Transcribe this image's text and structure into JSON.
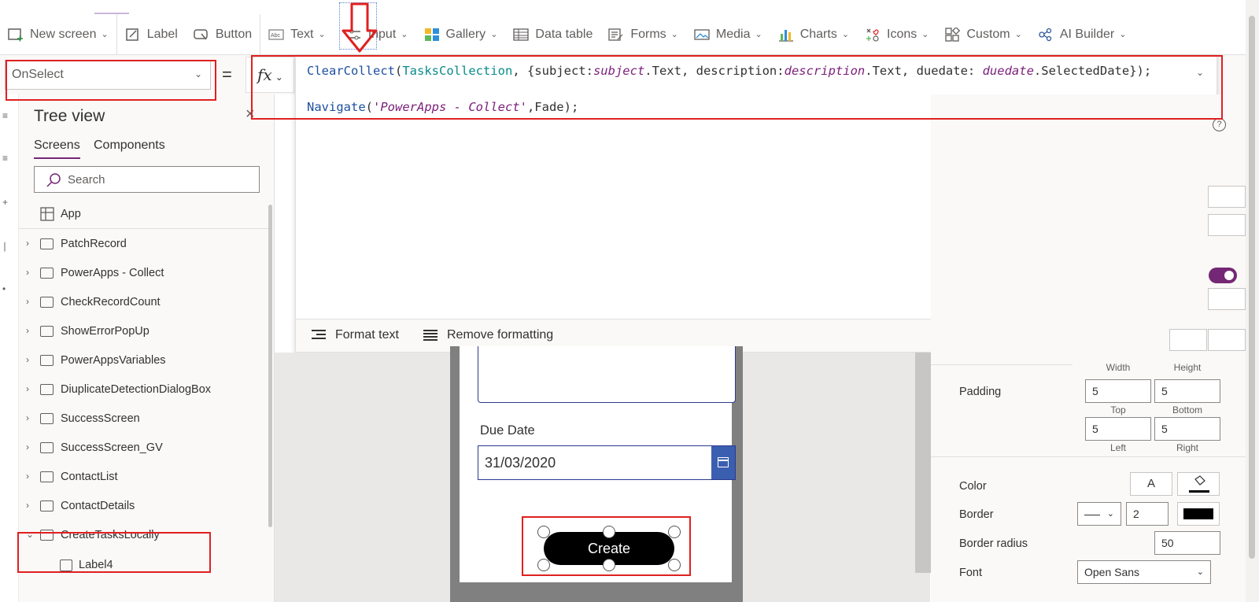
{
  "ribbon": {
    "items": [
      {
        "label": "New screen",
        "icon": "new-screen-icon",
        "dropdown": true
      },
      {
        "label": "Label",
        "icon": "label-icon",
        "dropdown": false
      },
      {
        "label": "Button",
        "icon": "button-icon",
        "dropdown": false
      },
      {
        "label": "Text",
        "icon": "text-icon",
        "dropdown": true
      },
      {
        "label": "Input",
        "icon": "input-icon",
        "dropdown": true
      },
      {
        "label": "Gallery",
        "icon": "gallery-icon",
        "dropdown": true
      },
      {
        "label": "Data table",
        "icon": "data-table-icon",
        "dropdown": false
      },
      {
        "label": "Forms",
        "icon": "forms-icon",
        "dropdown": true
      },
      {
        "label": "Media",
        "icon": "media-icon",
        "dropdown": true
      },
      {
        "label": "Charts",
        "icon": "charts-icon",
        "dropdown": true
      },
      {
        "label": "Icons",
        "icon": "icons-icon",
        "dropdown": true
      },
      {
        "label": "Custom",
        "icon": "custom-icon",
        "dropdown": true
      },
      {
        "label": "AI Builder",
        "icon": "ai-builder-icon",
        "dropdown": true
      }
    ]
  },
  "property_bar": {
    "selected_property": "OnSelect",
    "equals": "=",
    "fx": "fx"
  },
  "formula": {
    "line1": {
      "fn": "ClearCollect",
      "open": "(",
      "collection": "TasksCollection",
      "rest1": ", {subject:",
      "v1": "subject",
      "rest2": ".Text, description:",
      "v2": "description",
      "rest3": ".Text, duedate: ",
      "v3": "duedate",
      "rest4": ".SelectedDate});"
    },
    "line2": {
      "fn": "Navigate",
      "open": "(",
      "str": "'PowerApps - Collect'",
      "rest": ",Fade);"
    },
    "format_text": "Format text",
    "remove_formatting": "Remove formatting"
  },
  "tree": {
    "title": "Tree view",
    "tabs": {
      "screens": "Screens",
      "components": "Components"
    },
    "search_placeholder": "Search",
    "app_label": "App",
    "screens": [
      "PatchRecord",
      "PowerApps - Collect",
      "CheckRecordCount",
      "ShowErrorPopUp",
      "PowerAppsVariables",
      "DiuplicateDetectionDialogBox",
      "SuccessScreen",
      "SuccessScreen_GV",
      "ContactList",
      "ContactDetails",
      "CreateTasksLocally"
    ],
    "child": "Label4"
  },
  "canvas": {
    "due_date_label": "Due Date",
    "due_date_value": "31/03/2020",
    "create_button": "Create"
  },
  "properties": {
    "width_label": "Width",
    "height_label": "Height",
    "padding_label": "Padding",
    "padding": {
      "top": "5",
      "bottom": "5",
      "left": "5",
      "right": "5"
    },
    "top_label": "Top",
    "bottom_label": "Bottom",
    "left_label": "Left",
    "right_label": "Right",
    "color_label": "Color",
    "color_text_glyph": "A",
    "border_label": "Border",
    "border_width": "2",
    "border_radius_label": "Border radius",
    "border_radius": "50",
    "font_label": "Font",
    "font_value": "Open Sans"
  },
  "colors": {
    "accent": "#742774",
    "annotation": "#e02020",
    "date_button": "#3b5fb0"
  }
}
